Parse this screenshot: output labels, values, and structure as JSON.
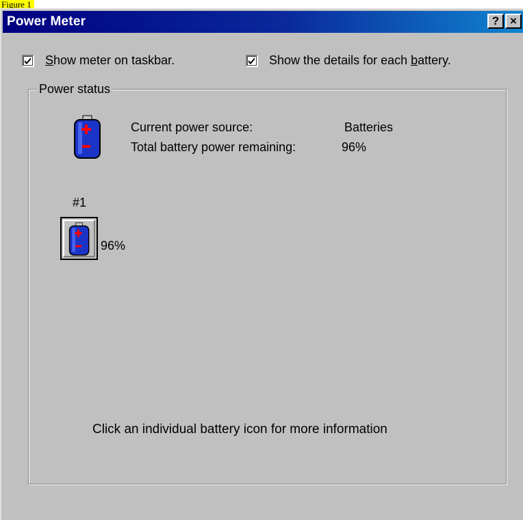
{
  "figure_label": "Figure 1",
  "window": {
    "title": "Power Meter",
    "help_label": "?",
    "close_label": "×"
  },
  "checkboxes": [
    {
      "prefix": "",
      "accel": "S",
      "suffix": "how meter on taskbar.",
      "checked": true
    },
    {
      "prefix": "Show the details for each ",
      "accel": "b",
      "suffix": "attery.",
      "checked": true
    }
  ],
  "power_status": {
    "group_label": "Power status",
    "current_source_label": "Current power source:",
    "current_source_value": "Batteries",
    "remaining_label": "Total battery power remaining:",
    "remaining_value": "96%",
    "battery_icon": "battery-icon"
  },
  "batteries": [
    {
      "number_label": "#1",
      "percent": "96%",
      "icon": "battery-icon"
    }
  ],
  "hint": "Click an individual battery icon for more information",
  "colors": {
    "title_start": "#000080",
    "title_end": "#1084d0",
    "dialog_face": "#c0c0c0",
    "battery_body": "#1b34c8",
    "battery_plus": "#ff0000",
    "figure_label_bg": "#ffff00"
  }
}
